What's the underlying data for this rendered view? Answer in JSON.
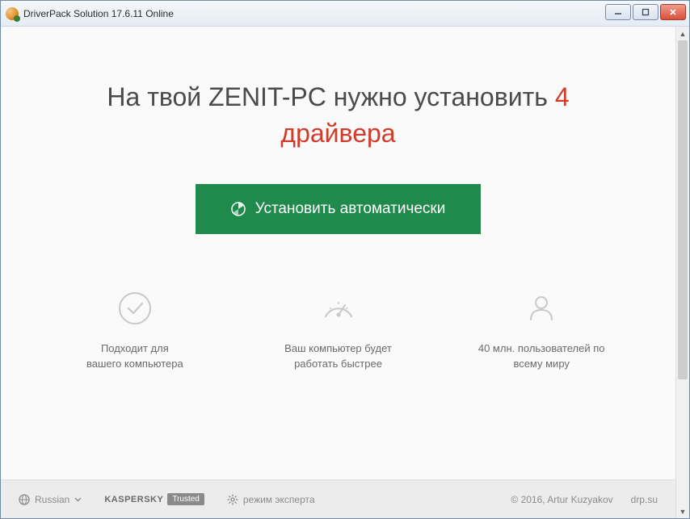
{
  "window": {
    "title": "DriverPack Solution 17.6.11 Online"
  },
  "headline": {
    "prefix": "На твой ",
    "pcname": "ZENIT-PC",
    "middle": " нужно установить ",
    "count": "4",
    "suffix": "драйвера"
  },
  "install": {
    "label": "Установить автоматически"
  },
  "features": [
    {
      "line1": "Подходит для",
      "line2": "вашего компьютера"
    },
    {
      "line1": "Ваш компьютер будет",
      "line2": "работать быстрее"
    },
    {
      "line1": "40 млн. пользователей по",
      "line2": "всему миру"
    }
  ],
  "footer": {
    "language": "Russian",
    "kaspersky": "KASPERSKY",
    "trusted": "Trusted",
    "expert": "режим эксперта",
    "copyright": "© 2016, Artur Kuzyakov",
    "site": "drp.su"
  }
}
